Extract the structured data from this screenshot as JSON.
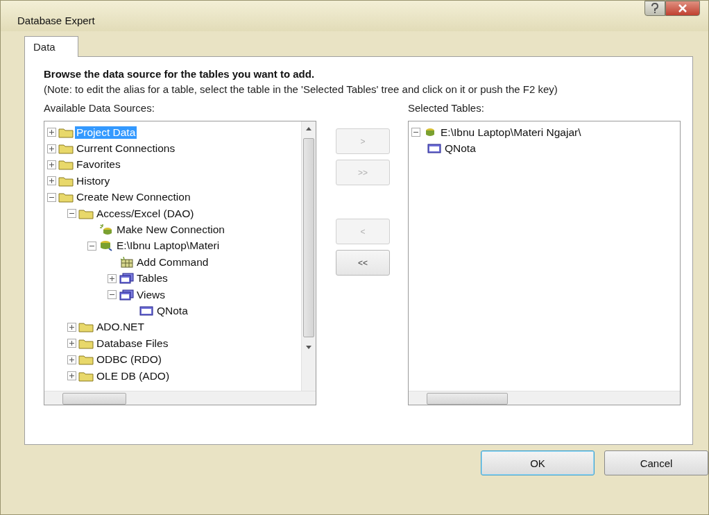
{
  "window": {
    "title": "Database Expert"
  },
  "tabs": [
    {
      "label": "Data",
      "selected": true
    }
  ],
  "heading": "Browse the data source for the tables you want to add.",
  "note": "(Note: to edit the alias for a table, select the table in the 'Selected Tables' tree and click on it or push the F2 key)",
  "available": {
    "label": "Available Data Sources:",
    "tree": [
      {
        "kind": "folder",
        "label": "Project Data",
        "expanded": false,
        "selected": true
      },
      {
        "kind": "folder",
        "label": "Current Connections",
        "expanded": false,
        "selected": false
      },
      {
        "kind": "folder",
        "label": "Favorites",
        "expanded": false,
        "selected": false
      },
      {
        "kind": "folder",
        "label": "History",
        "expanded": false,
        "selected": false
      },
      {
        "kind": "folder",
        "label": "Create New Connection",
        "expanded": true,
        "selected": false,
        "children": [
          {
            "kind": "folder",
            "label": "Access/Excel (DAO)",
            "expanded": true,
            "selected": false,
            "children": [
              {
                "kind": "new-connection",
                "label": "Make New Connection",
                "selected": false
              },
              {
                "kind": "database",
                "label": "E:\\Ibnu Laptop\\Materi",
                "expanded": true,
                "selected": false,
                "children": [
                  {
                    "kind": "command",
                    "label": "Add Command",
                    "selected": false
                  },
                  {
                    "kind": "table-group",
                    "label": "Tables",
                    "expanded": false,
                    "selected": false
                  },
                  {
                    "kind": "table-group",
                    "label": "Views",
                    "expanded": true,
                    "selected": false,
                    "children": [
                      {
                        "kind": "view",
                        "label": "QNota",
                        "selected": false
                      }
                    ]
                  }
                ]
              }
            ]
          },
          {
            "kind": "folder",
            "label": "ADO.NET",
            "expanded": false,
            "selected": false
          },
          {
            "kind": "folder",
            "label": "Database Files",
            "expanded": false,
            "selected": false
          },
          {
            "kind": "folder",
            "label": "ODBC (RDO)",
            "expanded": false,
            "selected": false
          },
          {
            "kind": "folder",
            "label": "OLE DB (ADO)",
            "expanded": false,
            "selected": false
          }
        ]
      }
    ]
  },
  "transfer_buttons": [
    {
      "label": ">",
      "disabled": true
    },
    {
      "label": ">>",
      "disabled": true
    },
    {
      "label": "<",
      "disabled": true
    },
    {
      "label": "<<",
      "disabled": false
    }
  ],
  "selected_tables": {
    "label": "Selected Tables:",
    "tree": [
      {
        "kind": "database",
        "label": "E:\\Ibnu Laptop\\Materi Ngajar\\",
        "expanded": true,
        "selected": false,
        "children": [
          {
            "kind": "view",
            "label": "QNota",
            "selected": false
          }
        ]
      }
    ]
  },
  "buttons": [
    {
      "label": "OK",
      "default": true
    },
    {
      "label": "Cancel",
      "default": false
    }
  ]
}
